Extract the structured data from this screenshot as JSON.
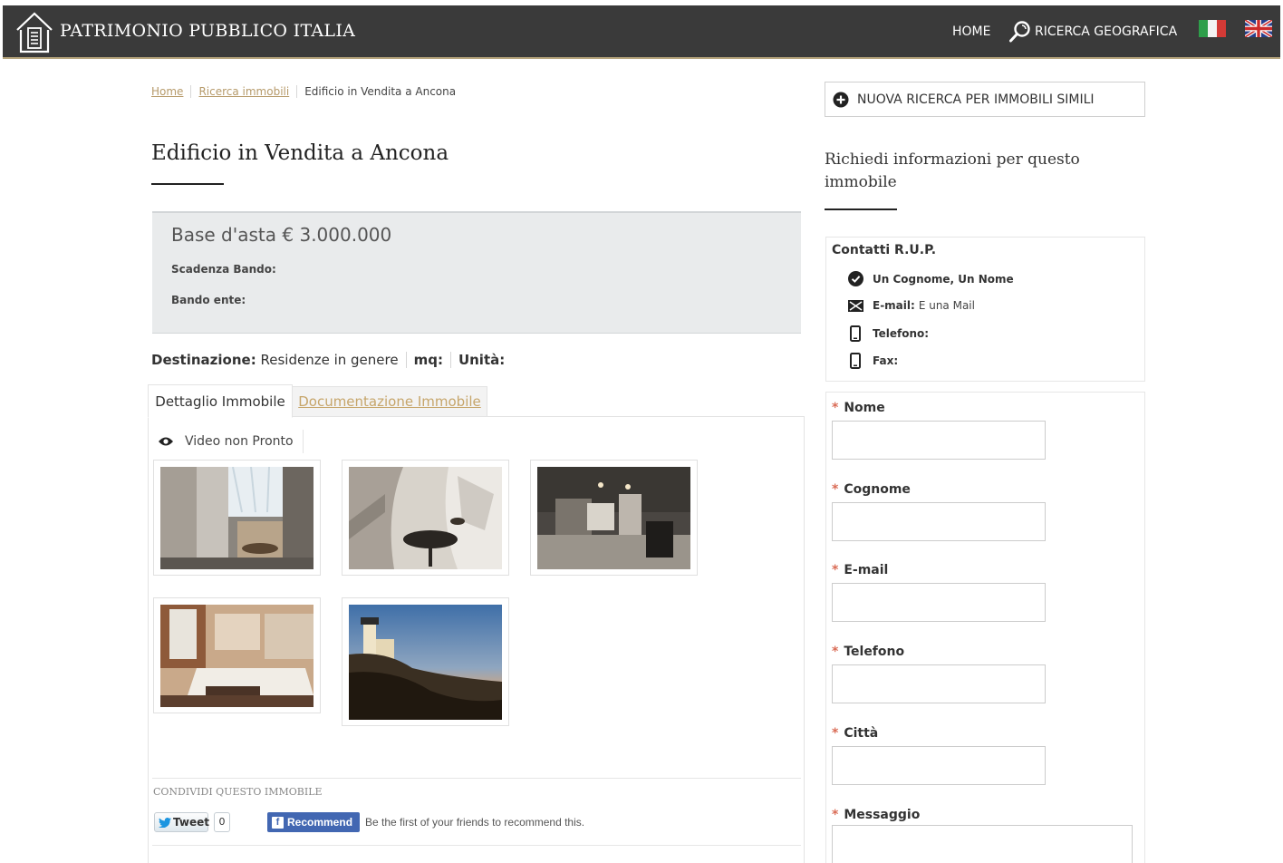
{
  "header": {
    "brand": "PATRIMONIO PUBBLICO ITALIA",
    "nav_home": "HOME",
    "nav_geo": "RICERCA GEOGRAFICA"
  },
  "breadcrumb": {
    "home": "Home",
    "search": "Ricerca immobili",
    "current": "Edificio in Vendita a Ancona"
  },
  "listing": {
    "title": "Edificio in Vendita a Ancona",
    "price": "Base d'asta € 3.000.000",
    "scadenza_label": "Scadenza Bando:",
    "bando_label": "Bando ente:",
    "destinazione_label": "Destinazione:",
    "destinazione_value": "Residenze in genere",
    "mq_label": "mq:",
    "unita_label": "Unità:"
  },
  "tabs": {
    "dettaglio": "Dettaglio Immobile",
    "documentazione": "Documentazione Immobile"
  },
  "video": {
    "label": "Video non Pronto"
  },
  "share": {
    "label": "CONDIVIDI QUESTO IMMOBILE",
    "tweet": "Tweet",
    "tweet_count": "0",
    "recommend": "Recommend",
    "fb_text": "Be the first of your friends to recommend this."
  },
  "sidebar": {
    "new_search": "NUOVA RICERCA PER IMMOBILI SIMILI",
    "request_title": "Richiedi informazioni per questo immobile",
    "contacts_title": "Contatti R.U.P.",
    "contact_name": "Un Cognome, Un Nome",
    "email_label": "E-mail:",
    "email_value": "E una Mail",
    "phone_label": "Telefono:",
    "fax_label": "Fax:"
  },
  "form": {
    "nome": "Nome",
    "cognome": "Cognome",
    "email": "E-mail",
    "telefono": "Telefono",
    "citta": "Città",
    "messaggio": "Messaggio"
  },
  "colors": {
    "header_bg": "#3a3a3a",
    "accent": "#b69a6a",
    "price_box_bg": "#e9ebec",
    "required_star": "#d96b55",
    "facebook": "#4267b2"
  }
}
